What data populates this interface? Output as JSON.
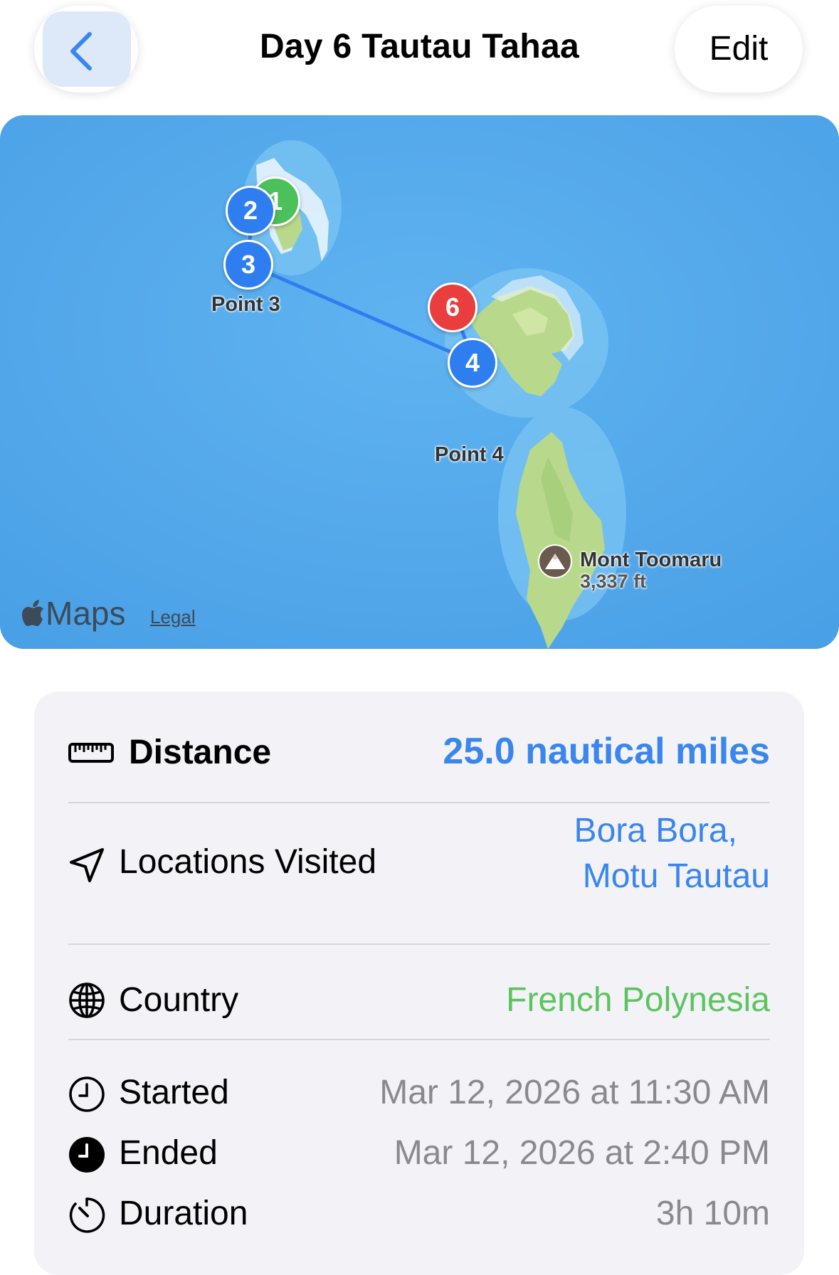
{
  "header": {
    "title": "Day 6 Tautau Tahaa",
    "edit_label": "Edit"
  },
  "map": {
    "pins": [
      {
        "label": "1",
        "color": "#4cc05a"
      },
      {
        "label": "2",
        "color": "#2f7ef0"
      },
      {
        "label": "3",
        "color": "#2f7ef0"
      },
      {
        "label": "4",
        "color": "#2f7ef0"
      },
      {
        "label": "6",
        "color": "#ea3d3d"
      }
    ],
    "point3_label": "Point 3",
    "point4_label": "Point 4",
    "peak_name": "Mont Toomaru",
    "peak_elevation": "3,337 ft",
    "maps_brand": "Maps",
    "legal_label": "Legal"
  },
  "details": {
    "distance": {
      "icon": "ruler-icon",
      "label": "Distance",
      "value": "25.0 nautical miles"
    },
    "locations": {
      "icon": "location-arrow-icon",
      "label": "Locations Visited",
      "value_line1": "Bora Bora,",
      "value_line2": "Motu Tautau"
    },
    "country": {
      "icon": "globe-icon",
      "label": "Country",
      "value": "French Polynesia"
    },
    "started": {
      "icon": "clock-outline-icon",
      "label": "Started",
      "value": "Mar 12, 2026 at 11:30 AM"
    },
    "ended": {
      "icon": "clock-filled-icon",
      "label": "Ended",
      "value": "Mar 12, 2026 at 2:40 PM"
    },
    "duration": {
      "icon": "timer-icon",
      "label": "Duration",
      "value": "3h 10m"
    }
  },
  "colors": {
    "accent_blue": "#3a86ec",
    "country_green": "#5cc45e",
    "secondary_gray": "#8a8a8e",
    "water": "#53a8ea",
    "land": "#b8d98c"
  }
}
